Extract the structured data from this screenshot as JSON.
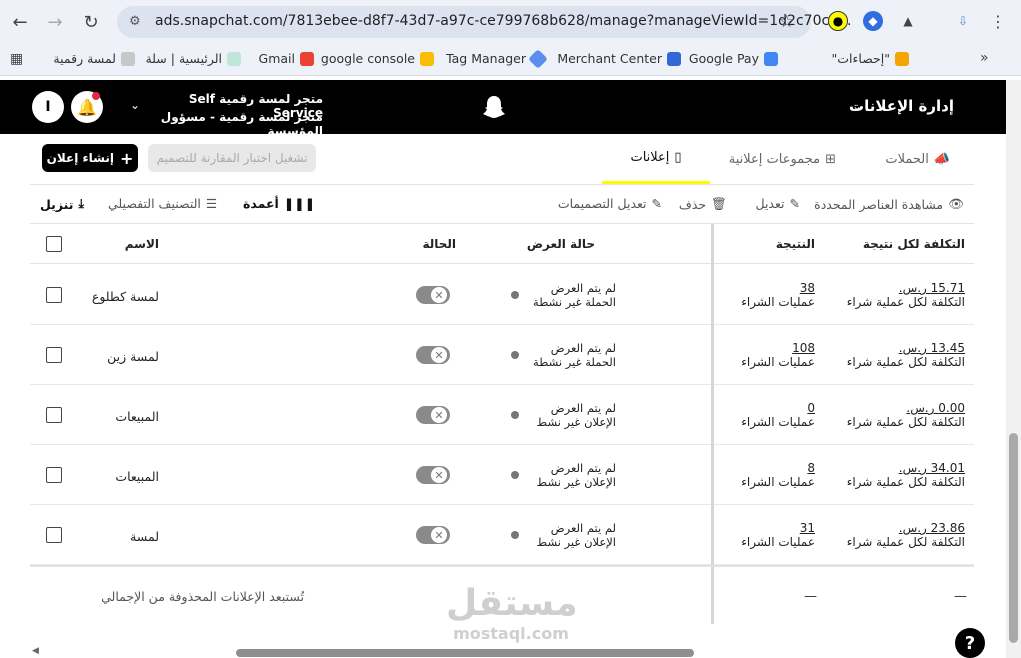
{
  "browser": {
    "url": "ads.snapchat.com/7813ebee-d8f7-43d7-a97c-ce799768b628/manage?manageViewId=1d2c70c4...",
    "bookmarks": [
      {
        "label": "\"إحصاءات\""
      },
      {
        "label": "Google Pay"
      },
      {
        "label": "Merchant Center"
      },
      {
        "label": "Tag Manager"
      },
      {
        "label": "google console"
      },
      {
        "label": "Gmail"
      },
      {
        "label": "الرئيسية | سلة"
      },
      {
        "label": "لمسة رقمية"
      }
    ]
  },
  "header": {
    "title": "إدارة الإعلانات",
    "org_line1": "متجر لمسة رقمية Self Service",
    "org_line2": "متجر لمسة رقمية - مسؤول المؤسسة",
    "avatar_letter": "I"
  },
  "tabs": {
    "campaigns": "الحملات",
    "ad_sets": "مجموعات إعلانية",
    "ads": "إعلانات",
    "ab_test": "تشغيل اختبار المقارنة للتصميم",
    "create": "إنشاء إعلان"
  },
  "toolbar": {
    "view_selected": "مشاهدة العناصر المحددة",
    "edit": "تعديل",
    "delete": "حذف",
    "edit_creatives": "تعديل التصميمات",
    "breakdown": "التصنيف التفصيلي",
    "columns": "أعمدة",
    "download": "تنزيل"
  },
  "table": {
    "headers": {
      "name": "الاسم",
      "status": "الحالة",
      "delivery": "حالة العرض",
      "result": "النتيجة",
      "cost_per_result": "التكلفة لكل نتيجة"
    },
    "rows": [
      {
        "name": "لمسة كطلوع",
        "delivery1": "لم يتم العرض",
        "delivery2": "الحملة غير نشطة",
        "result": "38",
        "result_label": "عمليات الشراء",
        "cost": "15.71 ر.س.",
        "cost_label": "التكلفة لكل عملية شراء"
      },
      {
        "name": "لمسة زين",
        "delivery1": "لم يتم العرض",
        "delivery2": "الحملة غير نشطة",
        "result": "108",
        "result_label": "عمليات الشراء",
        "cost": "13.45 ر.س.",
        "cost_label": "التكلفة لكل عملية شراء"
      },
      {
        "name": "المبيعات",
        "delivery1": "لم يتم العرض",
        "delivery2": "الإعلان غير نشط",
        "result": "0",
        "result_label": "عمليات الشراء",
        "cost": "0.00 ر.س.",
        "cost_label": "التكلفة لكل عملية شراء"
      },
      {
        "name": "المبيعات",
        "delivery1": "لم يتم العرض",
        "delivery2": "الإعلان غير نشط",
        "result": "8",
        "result_label": "عمليات الشراء",
        "cost": "34.01 ر.س.",
        "cost_label": "التكلفة لكل عملية شراء"
      },
      {
        "name": "لمسة",
        "delivery1": "لم يتم العرض",
        "delivery2": "الإعلان غير نشط",
        "result": "31",
        "result_label": "عمليات الشراء",
        "cost": "23.86 ر.س.",
        "cost_label": "التكلفة لكل عملية شراء"
      }
    ],
    "footer_note": "تُستبعد الإعلانات المحذوفة من الإجمالي",
    "footer_result": "—",
    "footer_cost": "—"
  },
  "watermark": {
    "logo": "مستقل",
    "site": "mostaql.com"
  },
  "help": "?"
}
